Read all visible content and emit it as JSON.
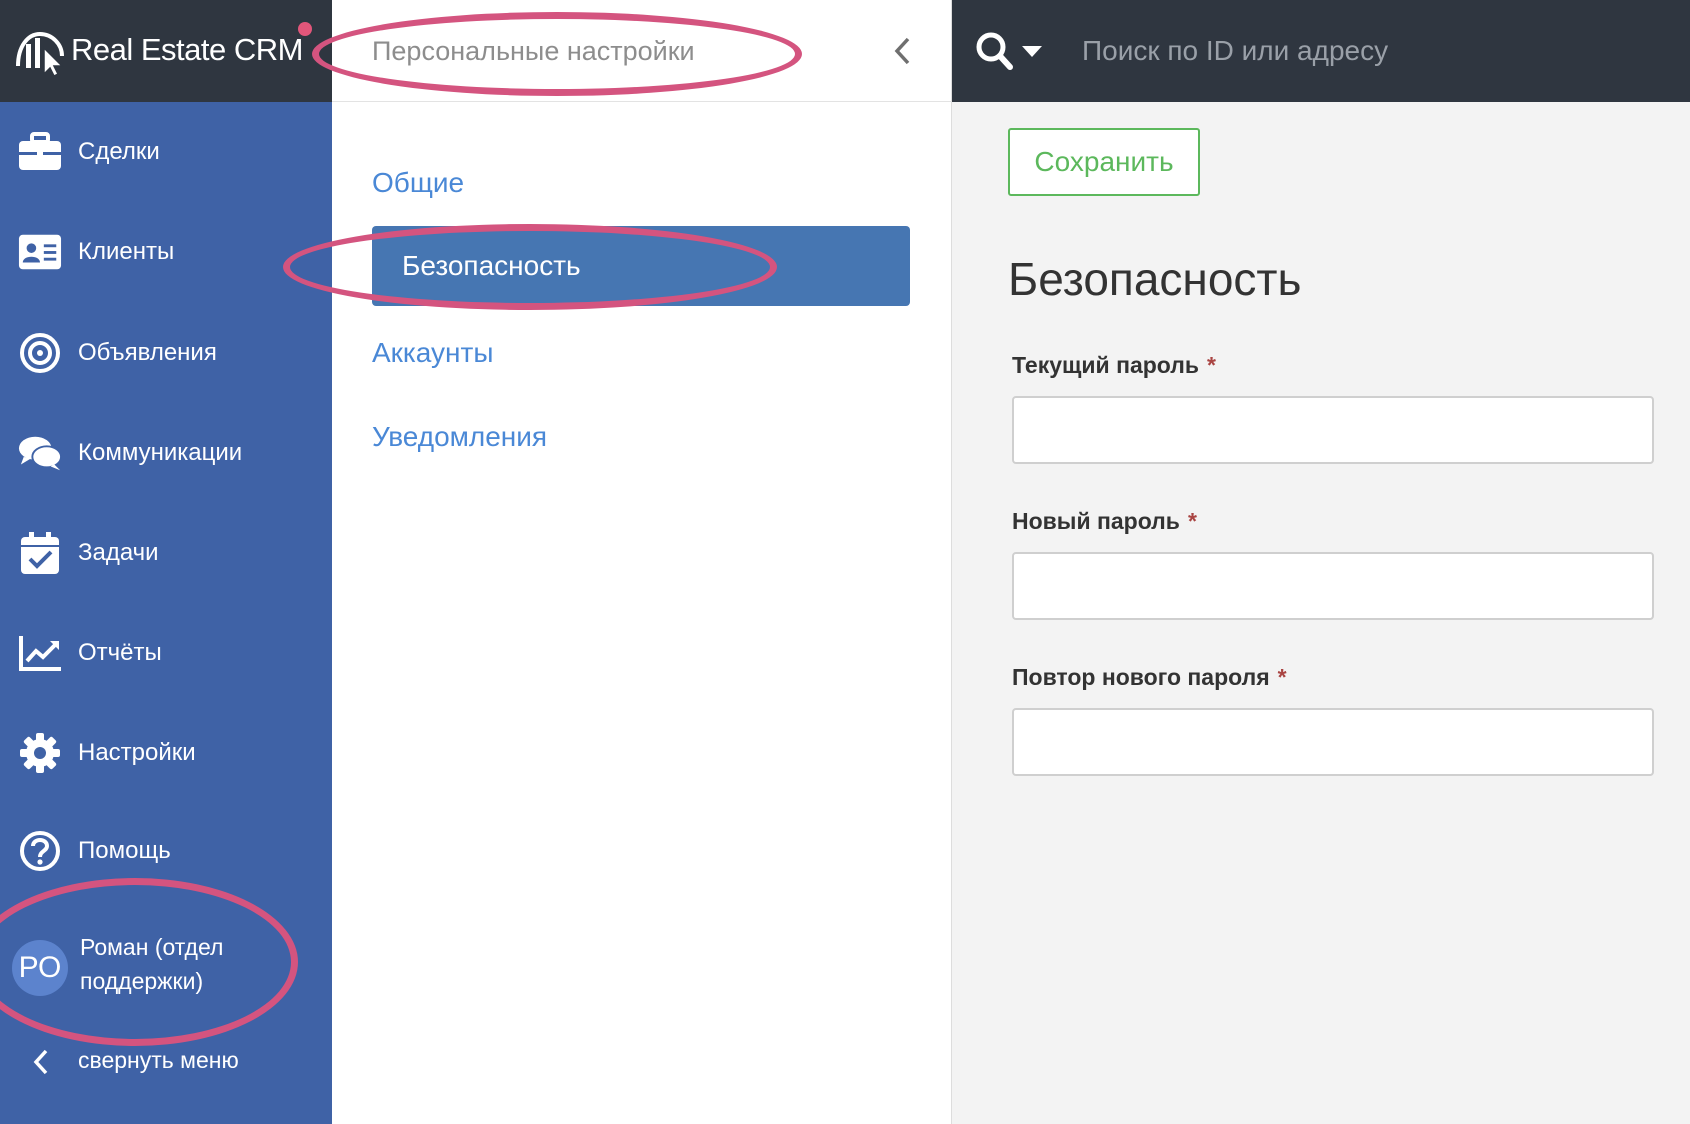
{
  "brand": {
    "name": "Real Estate CRM"
  },
  "sidebar": {
    "items": [
      {
        "label": "Сделки",
        "icon": "briefcase-icon"
      },
      {
        "label": "Клиенты",
        "icon": "contact-card-icon"
      },
      {
        "label": "Объявления",
        "icon": "target-icon"
      },
      {
        "label": "Коммуникации",
        "icon": "chat-bubbles-icon"
      },
      {
        "label": "Задачи",
        "icon": "calendar-check-icon"
      },
      {
        "label": "Отчёты",
        "icon": "line-chart-icon"
      },
      {
        "label": "Настройки",
        "icon": "gear-icon"
      },
      {
        "label": "Помощь",
        "icon": "question-circle-icon"
      }
    ],
    "user": {
      "initials": "РО",
      "name": "Роман (отдел поддержки)"
    },
    "collapse_label": "свернуть меню"
  },
  "settings_nav": {
    "title": "Персональные настройки",
    "items": [
      {
        "label": "Общие",
        "active": false
      },
      {
        "label": "Безопасность",
        "active": true
      },
      {
        "label": "Аккаунты",
        "active": false
      },
      {
        "label": "Уведомления",
        "active": false
      }
    ]
  },
  "search": {
    "placeholder": "Поиск по ID или адресу"
  },
  "content": {
    "save_label": "Сохранить",
    "title": "Безопасность",
    "fields": [
      {
        "label": "Текущий пароль",
        "required": "*",
        "value": ""
      },
      {
        "label": "Новый пароль",
        "required": "*",
        "value": ""
      },
      {
        "label": "Повтор нового пароля",
        "required": "*",
        "value": ""
      }
    ]
  },
  "colors": {
    "sidebar": "#3f62a6",
    "topbar": "#2f3640",
    "accent_active": "#4676b2",
    "link": "#4a88d6",
    "save": "#5cb85c",
    "annotation": "#d4547f"
  }
}
